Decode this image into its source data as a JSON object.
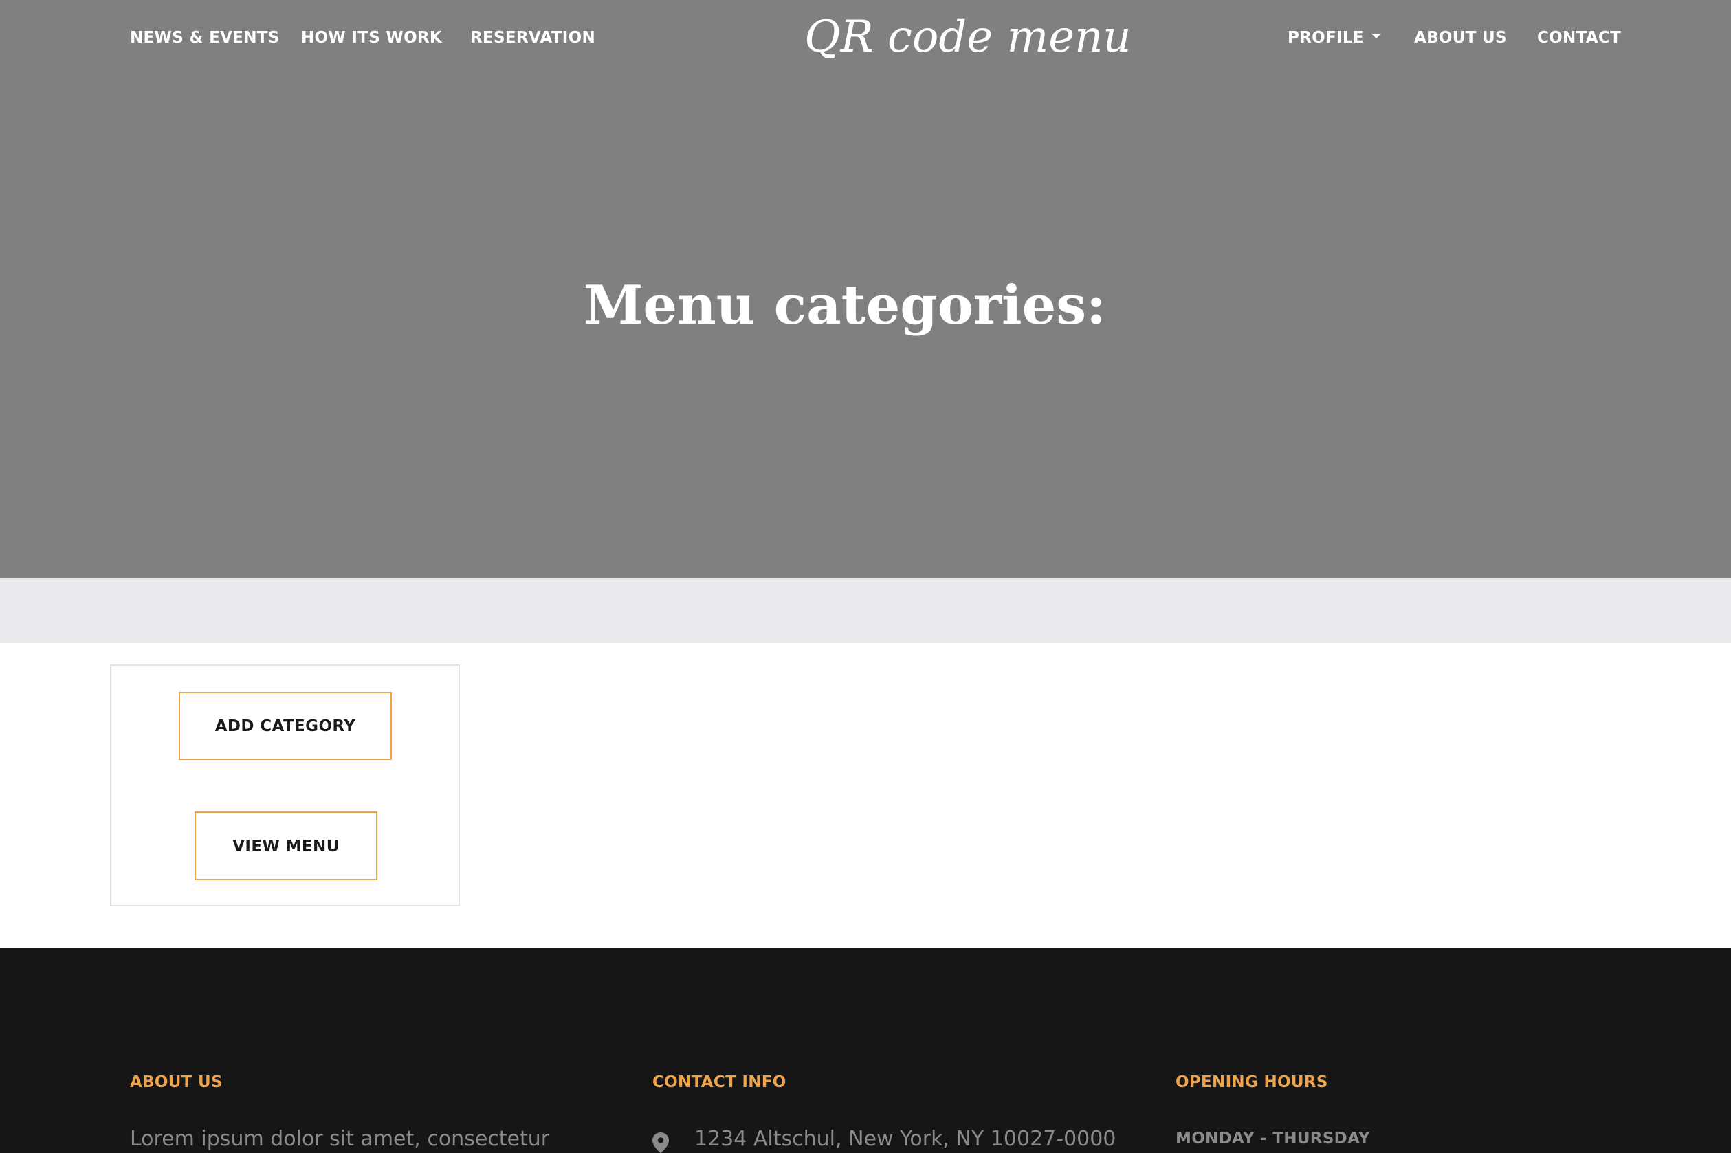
{
  "nav": {
    "brand": "QR code menu",
    "left_items": [
      {
        "label": "NEWS & EVENTS"
      },
      {
        "label": "HOW ITS WORK"
      },
      {
        "label": "RESERVATION"
      }
    ],
    "right_items": [
      {
        "label": "PROFILE",
        "dropdown": true
      },
      {
        "label": "ABOUT US"
      },
      {
        "label": "CONTACT"
      }
    ]
  },
  "hero": {
    "title": "Menu categories:",
    "background_color": "#808080"
  },
  "actions": {
    "add_category_label": "ADD CATEGORY",
    "view_menu_label": "VIEW MENU",
    "accent_color": "#f0a44a"
  },
  "footer": {
    "about": {
      "heading": "ABOUT US",
      "text": "Lorem ipsum dolor sit amet, consectetur"
    },
    "contact": {
      "heading": "CONTACT INFO",
      "address": "1234 Altschul, New York, NY 10027-0000",
      "icon": "map-pin-icon"
    },
    "hours": {
      "heading": "OPENING HOURS",
      "days": "MONDAY - THURSDAY"
    },
    "background_color": "#161616"
  }
}
